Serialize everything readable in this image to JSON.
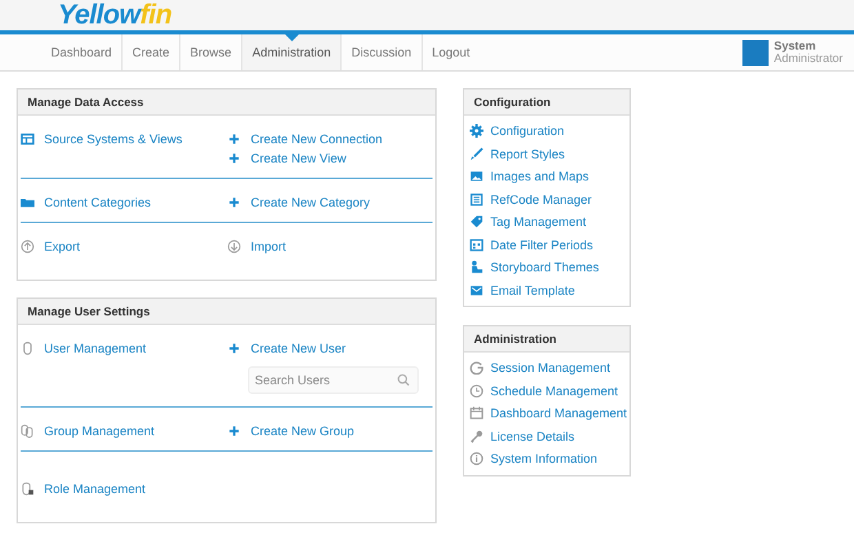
{
  "logo": "Yellowfin",
  "nav": [
    {
      "label": "Dashboard",
      "selected": false
    },
    {
      "label": "Create",
      "selected": false
    },
    {
      "label": "Browse",
      "selected": false
    },
    {
      "label": "Administration",
      "selected": true
    },
    {
      "label": "Discussion",
      "selected": false
    },
    {
      "label": "Logout",
      "selected": false
    }
  ],
  "user": {
    "first": "System",
    "second": "Administrator"
  },
  "left_panels": [
    {
      "title": "Manage Data Access",
      "sections": [
        {
          "link": "Source Systems & Views",
          "actions": [
            {
              "kind": "create",
              "label": "Create New Connection"
            },
            {
              "kind": "create",
              "label": "Create New View"
            }
          ]
        },
        {
          "link": "Content Categories",
          "actions": [
            {
              "kind": "create",
              "label": "Create New Category"
            }
          ]
        },
        {
          "link": "Export",
          "actions": [
            {
              "kind": "link",
              "label": "Import"
            }
          ]
        }
      ]
    },
    {
      "title": "Manage User Settings",
      "sections": [
        {
          "link": "User Management",
          "actions": [
            {
              "kind": "create",
              "label": "Create New User"
            },
            {
              "kind": "search",
              "placeholder": "Search Users"
            }
          ]
        },
        {
          "link": "Group Management",
          "actions": [
            {
              "kind": "create",
              "label": "Create New Group"
            }
          ]
        },
        {
          "link": "Role Management"
        }
      ]
    }
  ],
  "right_panels": [
    {
      "title": "Configuration",
      "items": [
        "Configuration",
        "Report Styles",
        "Images and Maps",
        "RefCode Manager",
        "Tag Management",
        "Date Filter Periods",
        "Storyboard Themes",
        "Email Template"
      ]
    },
    {
      "title": "Administration",
      "items": [
        "Session Management",
        "Schedule Management",
        "Dashboard Management",
        "License Details",
        "System Information"
      ]
    }
  ]
}
